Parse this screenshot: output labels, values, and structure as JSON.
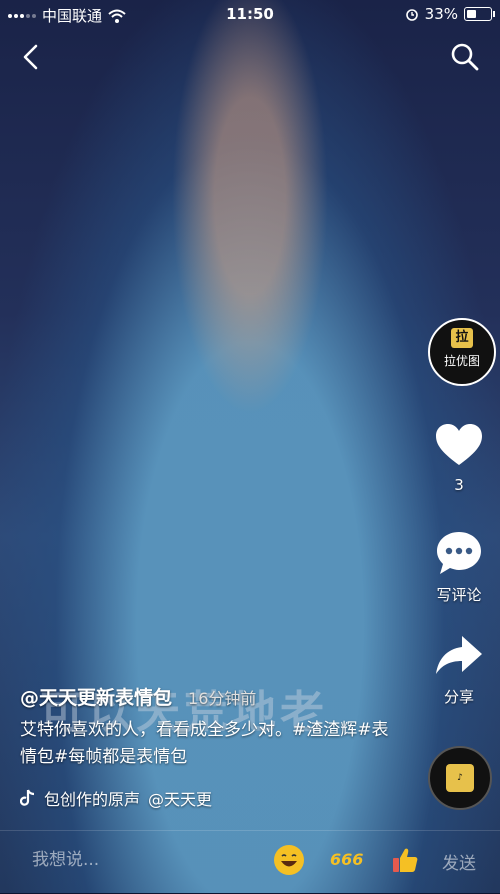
{
  "status_bar": {
    "carrier": "中国联通",
    "time": "11:50",
    "battery": "33%",
    "battery_level": 0.33
  },
  "watermark": {
    "text": "拉优图"
  },
  "actions": {
    "like_count": "3",
    "comment_label": "写评论",
    "share_label": "分享"
  },
  "overlay_caption": "可以天荒地老",
  "post": {
    "author": "@天天更新表情包",
    "time_ago": "16分钟前",
    "description": "艾特你喜欢的人，看看成全多少对。#渣渣辉#表情包#每帧都是表情包",
    "music_source": "包创作的原声",
    "music_author": "@天天更"
  },
  "comment_bar": {
    "placeholder": "我想说...",
    "send_label": "发送",
    "emoji_666": "666"
  },
  "colors": {
    "accent_gold": "#e7c14b",
    "emoji_yellow": "#f5c024"
  }
}
